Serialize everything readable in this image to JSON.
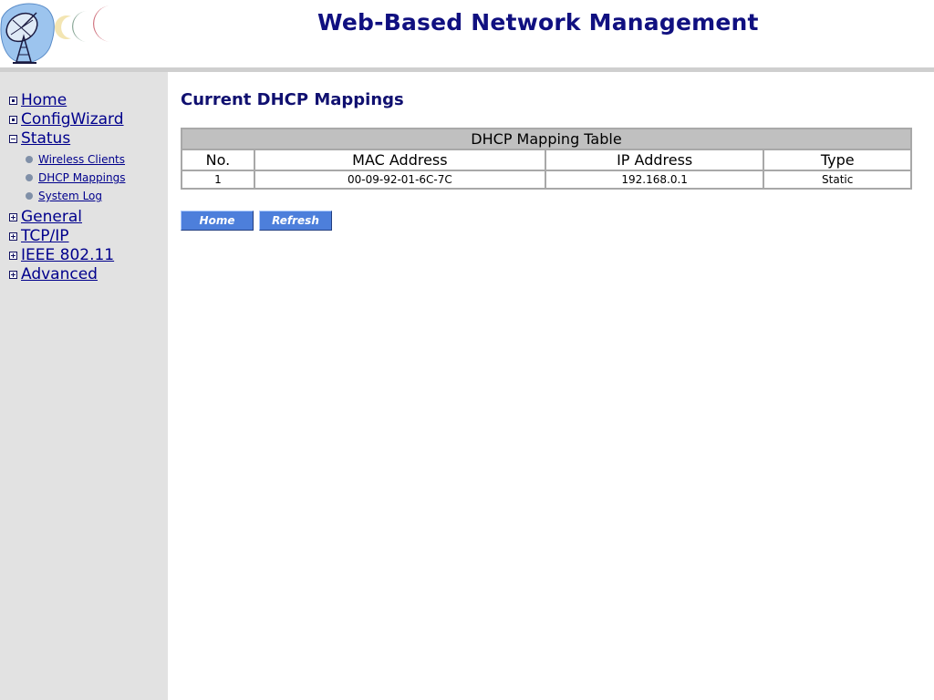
{
  "header": {
    "title": "Web-Based Network Management"
  },
  "sidebar": {
    "items": [
      {
        "label": "Home",
        "marker": "dot"
      },
      {
        "label": "ConfigWizard",
        "marker": "dot"
      },
      {
        "label": "Status",
        "marker": "minus"
      },
      {
        "label": "General",
        "marker": "plus"
      },
      {
        "label": "TCP/IP",
        "marker": "plus"
      },
      {
        "label": "IEEE 802.11",
        "marker": "plus"
      },
      {
        "label": "Advanced",
        "marker": "plus"
      }
    ],
    "status_subitems": [
      {
        "label": "Wireless Clients"
      },
      {
        "label": "DHCP Mappings"
      },
      {
        "label": "System Log"
      }
    ]
  },
  "main": {
    "heading": "Current DHCP Mappings",
    "table": {
      "caption": "DHCP Mapping Table",
      "columns": [
        "No.",
        "MAC Address",
        "IP Address",
        "Type"
      ],
      "rows": [
        [
          "1",
          "00-09-92-01-6C-7C",
          "192.168.0.1",
          "Static"
        ]
      ]
    },
    "buttons": {
      "home": "Home",
      "refresh": "Refresh"
    }
  },
  "colors": {
    "title": "#101080",
    "link": "#00008c",
    "sidebar_bg": "#e2e2e2",
    "button_bg": "#4d7fdb",
    "table_border": "#a8a8a8",
    "table_caption_bg": "#c0c0c0"
  },
  "icons": {
    "logo": "satellite-dish-logo-icon",
    "collapse_marker": "minus-box-icon",
    "expand_marker": "plus-box-icon",
    "page_marker": "dot-box-icon",
    "sub_bullet": "round-bullet-icon"
  }
}
